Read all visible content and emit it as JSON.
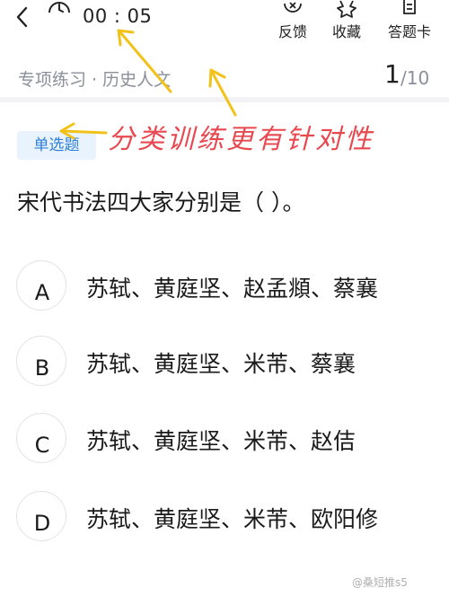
{
  "header": {
    "timer": "00 : 05",
    "tools": [
      {
        "label": "反馈",
        "icon": "feedback-x-icon"
      },
      {
        "label": "收藏",
        "icon": "star-icon"
      },
      {
        "label": "答题卡",
        "icon": "answer-card-icon"
      }
    ]
  },
  "subheader": {
    "category": "专项练习 · 历史人文",
    "current": "1",
    "total": "/10"
  },
  "annotation": {
    "text": "分类训练更有针对性",
    "color": "#e8484f"
  },
  "question": {
    "type_tag": "单选题",
    "text": "宋代书法四大家分别是（    ）。",
    "options": [
      {
        "letter": "A",
        "text": "苏轼、黄庭坚、赵孟頫、蔡襄"
      },
      {
        "letter": "B",
        "text": "苏轼、黄庭坚、米芾、蔡襄"
      },
      {
        "letter": "C",
        "text": "苏轼、黄庭坚、米芾、赵佶"
      },
      {
        "letter": "D",
        "text": "苏轼、黄庭坚、米芾、欧阳修"
      }
    ]
  },
  "watermark": "@桑短推s5",
  "colors": {
    "accent_blue": "#2f7fd6",
    "tag_bg": "#e8f3fd",
    "arrow_yellow": "#f2c21b"
  }
}
